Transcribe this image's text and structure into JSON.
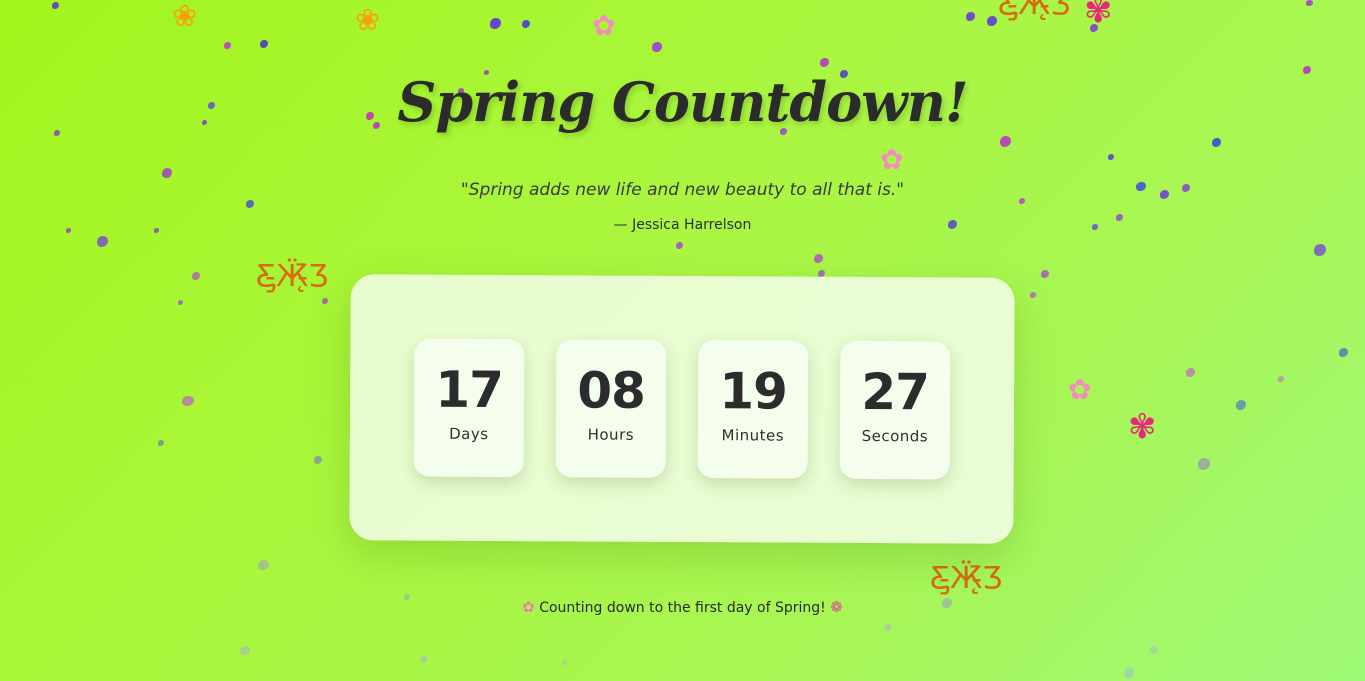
{
  "page": {
    "title": "Spring Countdown!",
    "quote": "\"Spring adds new life and new beauty to all that is.\"",
    "author": "— Jessica Harrelson"
  },
  "countdown": {
    "units": [
      {
        "value": "17",
        "label": "Days"
      },
      {
        "value": "08",
        "label": "Hours"
      },
      {
        "value": "19",
        "label": "Minutes"
      },
      {
        "value": "27",
        "label": "Seconds"
      }
    ]
  },
  "footer": {
    "text": "Counting down to the first day of Spring!",
    "leading_icon": "cherry-blossom-icon",
    "trailing_icon": "bouquet-icon"
  },
  "colors": {
    "background_start": "#a3f51c",
    "background_end": "#9ef976",
    "text": "#2b2b2b",
    "card": "#f5fdec"
  }
}
